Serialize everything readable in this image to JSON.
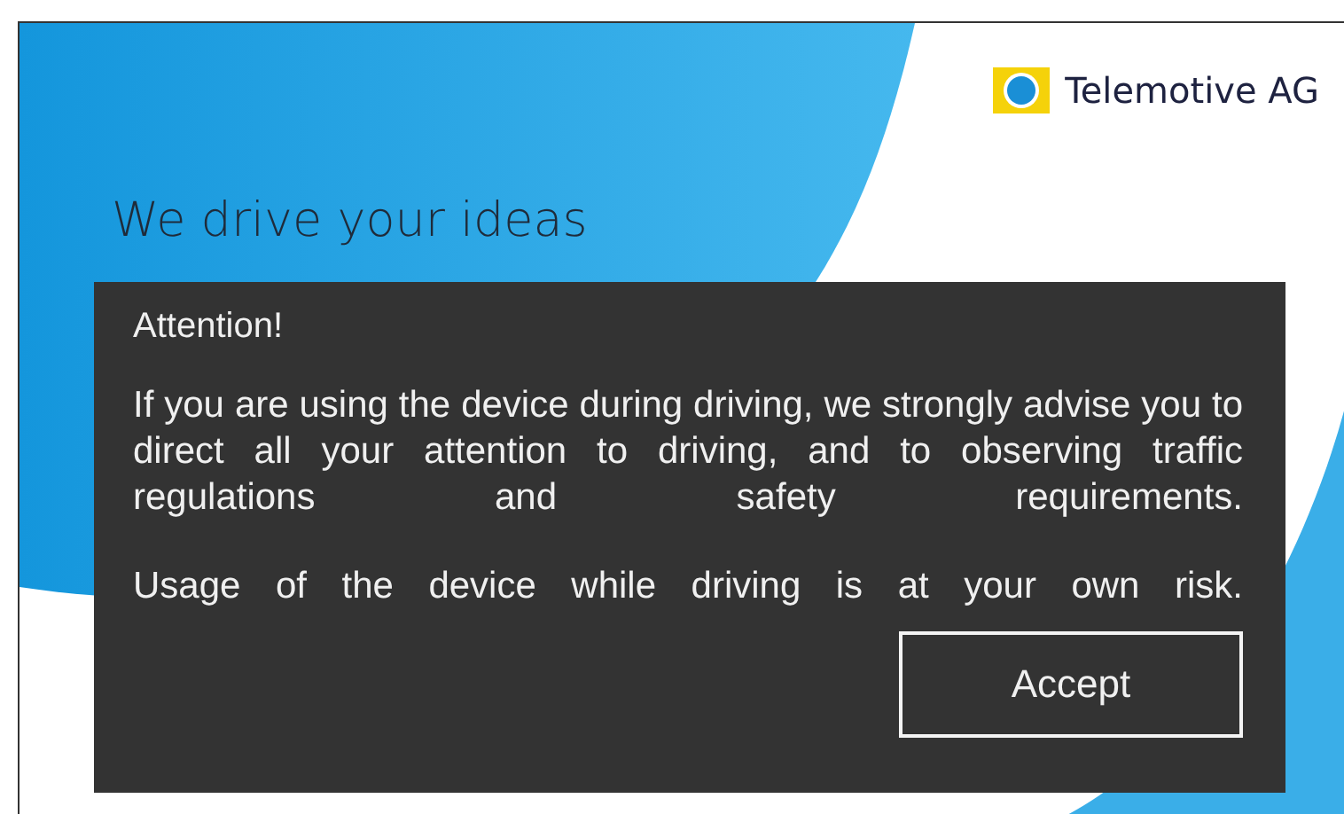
{
  "brand": {
    "name": "Telemotive AG"
  },
  "tagline": "We drive your ideas",
  "dialog": {
    "title": "Attention!",
    "paragraphs": [
      "If you are using the device during driving, we strongly advise you to direct all your attention to driving, and to observing traffic regulations and safety requirements.",
      "Usage of the device while driving is at your own risk."
    ],
    "buttons": [
      "Accept"
    ]
  }
}
